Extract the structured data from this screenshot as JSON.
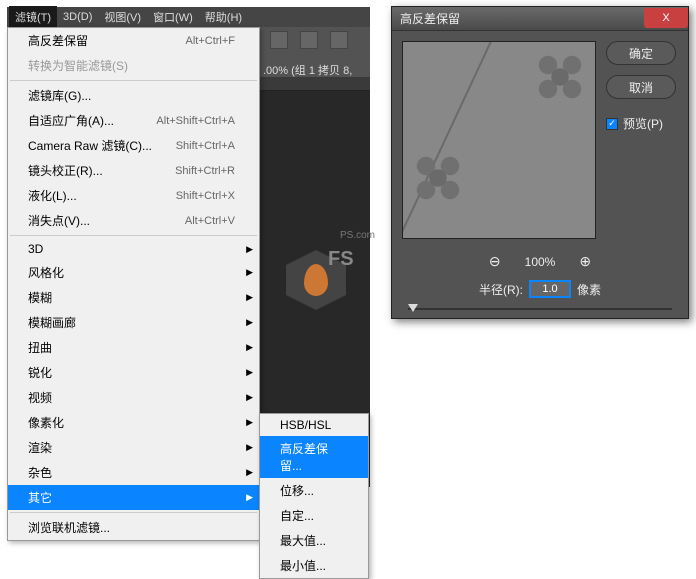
{
  "menubar": {
    "items": [
      {
        "label": "滤镜(T)"
      },
      {
        "label": "3D(D)"
      },
      {
        "label": "视图(V)"
      },
      {
        "label": "窗口(W)"
      },
      {
        "label": "帮助(H)"
      }
    ]
  },
  "info_pct": ".00% (组 1 拷贝 8,",
  "logo": {
    "text": "FS",
    "sub": "PS.com"
  },
  "dropdown": {
    "items": [
      {
        "label": "高反差保留",
        "shortcut": "Alt+Ctrl+F"
      },
      {
        "label": "转换为智能滤镜(S)",
        "disabled": true
      },
      {
        "sep": true
      },
      {
        "label": "滤镜库(G)..."
      },
      {
        "label": "自适应广角(A)...",
        "shortcut": "Alt+Shift+Ctrl+A"
      },
      {
        "label": "Camera Raw 滤镜(C)...",
        "shortcut": "Shift+Ctrl+A"
      },
      {
        "label": "镜头校正(R)...",
        "shortcut": "Shift+Ctrl+R"
      },
      {
        "label": "液化(L)...",
        "shortcut": "Shift+Ctrl+X"
      },
      {
        "label": "消失点(V)...",
        "shortcut": "Alt+Ctrl+V"
      },
      {
        "sep": true
      },
      {
        "label": "3D",
        "arrow": true
      },
      {
        "label": "风格化",
        "arrow": true
      },
      {
        "label": "模糊",
        "arrow": true
      },
      {
        "label": "模糊画廊",
        "arrow": true
      },
      {
        "label": "扭曲",
        "arrow": true
      },
      {
        "label": "锐化",
        "arrow": true
      },
      {
        "label": "视频",
        "arrow": true
      },
      {
        "label": "像素化",
        "arrow": true
      },
      {
        "label": "渲染",
        "arrow": true
      },
      {
        "label": "杂色",
        "arrow": true
      },
      {
        "label": "其它",
        "arrow": true,
        "highlighted": true
      },
      {
        "sep": true
      },
      {
        "label": "浏览联机滤镜..."
      }
    ]
  },
  "submenu": {
    "items": [
      {
        "label": "HSB/HSL"
      },
      {
        "label": "高反差保留...",
        "highlighted": true
      },
      {
        "label": "位移..."
      },
      {
        "label": "自定..."
      },
      {
        "label": "最大值..."
      },
      {
        "label": "最小值..."
      }
    ]
  },
  "dialog": {
    "title": "高反差保留",
    "close": "X",
    "ok": "确定",
    "cancel": "取消",
    "preview_label": "预览(P)",
    "zoom_pct": "100%",
    "radius_label": "半径(R):",
    "radius_value": "1.0",
    "radius_unit": "像素"
  }
}
